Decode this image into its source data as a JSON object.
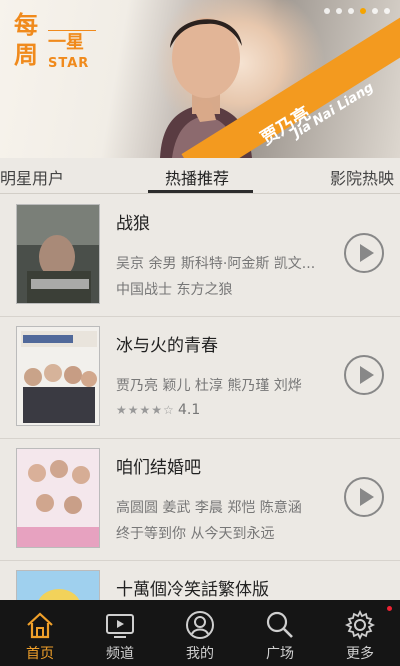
{
  "banner": {
    "logo": {
      "char1": "每",
      "char2": "周",
      "char3": "一星",
      "en": "STAR"
    },
    "name_cn": "贾乃亮",
    "name_en": "Jia Nai Liang",
    "accent": "#f39a1f"
  },
  "tabs": [
    {
      "label": "明星用户"
    },
    {
      "label": "热播推荐"
    },
    {
      "label": "影院热映"
    }
  ],
  "items": [
    {
      "title": "战狼",
      "cast": "吴京 余男 斯科特·阿金斯 凯文...",
      "tags": "中国战士 东方之狼",
      "poster_text": "战狼"
    },
    {
      "title": "冰与火的青春",
      "cast": "贾乃亮 颖儿 杜淳 熊乃瑾 刘烨",
      "stars": "★★★★☆",
      "rating": "4.1",
      "poster_text": "冰与火的青春"
    },
    {
      "title": "咱们结婚吧",
      "cast": "高圆圆 姜武 李晨 郑恺 陈意涵",
      "tags": "终于等到你 从今天到永远",
      "poster_text": "咱们结婚吧"
    },
    {
      "title": "十萬個冷笑話繁体版"
    }
  ],
  "nav": [
    {
      "label": "首页",
      "icon": "home-icon"
    },
    {
      "label": "频道",
      "icon": "tv-icon"
    },
    {
      "label": "我的",
      "icon": "user-icon"
    },
    {
      "label": "广场",
      "icon": "search-icon"
    },
    {
      "label": "更多",
      "icon": "gear-icon"
    }
  ],
  "colors": {
    "accent": "#f0a02a",
    "nav_bg": "#151515"
  }
}
